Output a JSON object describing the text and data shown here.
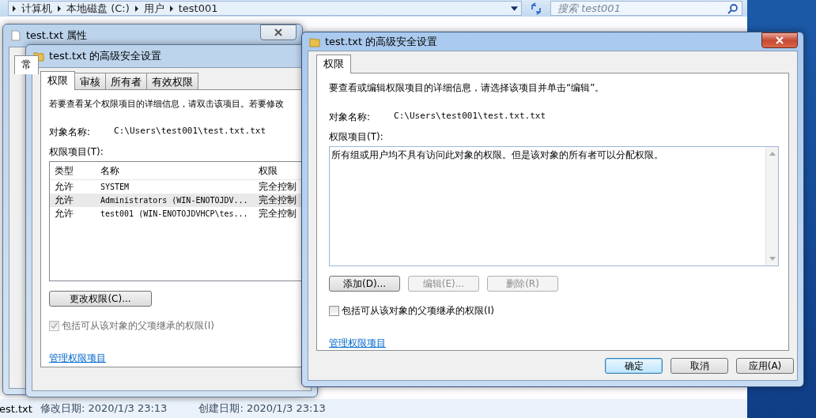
{
  "explorer": {
    "breadcrumbs": [
      "计算机",
      "本地磁盘 (C:)",
      "用户",
      "test001"
    ],
    "search": {
      "placeholder": "搜索 test001"
    },
    "status_bar": {
      "file": "est.txt",
      "modified": "修改日期: 2020/1/3 23:13",
      "created": "创建日期: 2020/1/3 23:13"
    }
  },
  "properties_window": {
    "title": "test.txt 属性",
    "tabs": [
      {
        "label": "常",
        "selected": true
      }
    ]
  },
  "back_window": {
    "title": "test.txt 的高级安全设置",
    "tabs": [
      {
        "label": "权限",
        "selected": true
      },
      {
        "label": "审核",
        "selected": false
      },
      {
        "label": "所有者",
        "selected": false
      },
      {
        "label": "有效权限",
        "selected": false
      }
    ],
    "description": "若要查看某个权限项目的详细信息，请双击该项目。若要修改",
    "object_label": "对象名称:",
    "object_path": "C:\\Users\\test001\\test.txt.txt",
    "entries_label": "权限项目(T):",
    "columns": [
      "类型",
      "名称",
      "权限"
    ],
    "rows": [
      {
        "cells": [
          "允许",
          "SYSTEM",
          "完全控制"
        ],
        "selected": false
      },
      {
        "cells": [
          "允许",
          "Administrators (WIN-ENOTOJDV...",
          "完全控制"
        ],
        "selected": true
      },
      {
        "cells": [
          "允许",
          "test001 (WIN-ENOTOJDVHCP\\tes...",
          "完全控制"
        ],
        "selected": false
      }
    ],
    "buttons": [
      {
        "label": "更改权限(C)...",
        "disabled": false
      }
    ],
    "inherit": {
      "label": "包括可从该对象的父项继承的权限(I)",
      "checked": true,
      "disabled": true
    },
    "link": "管理权限项目"
  },
  "front_window": {
    "title": "test.txt 的高级安全设置",
    "tabs": [
      {
        "label": "权限",
        "selected": true
      }
    ],
    "description": "要查看或编辑权限项目的详细信息，请选择该项目并单击“编辑”。",
    "object_label": "对象名称:",
    "object_path": "C:\\Users\\test001\\test.txt.txt",
    "entries_label": "权限项目(T):",
    "list_message": "所有组或用户均不具有访问此对象的权限。但是该对象的所有者可以分配权限。",
    "buttons": [
      {
        "label": "添加(D)...",
        "disabled": false
      },
      {
        "label": "编辑(E)...",
        "disabled": true
      },
      {
        "label": "删除(R)",
        "disabled": true
      }
    ],
    "inherit": {
      "label": "包括可从该对象的父项继承的权限(I)",
      "checked": false,
      "disabled": false
    },
    "link": "管理权限项目",
    "footer_buttons": [
      {
        "label": "确定",
        "default": true
      },
      {
        "label": "取消",
        "default": false
      },
      {
        "label": "应用(A)",
        "default": false
      }
    ]
  }
}
